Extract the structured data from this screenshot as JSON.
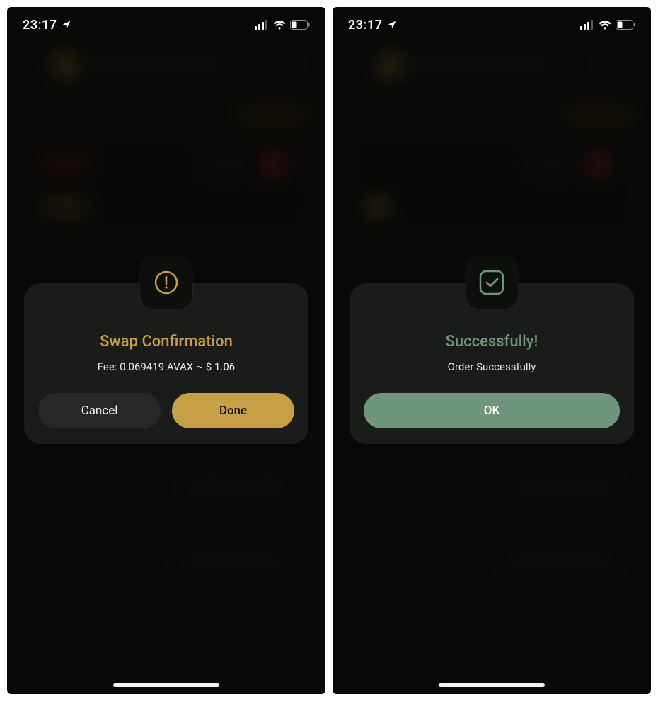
{
  "status": {
    "time": "23:17",
    "location_arrow": "➤"
  },
  "colors": {
    "gold": "#c79f45",
    "green": "#6f957c",
    "modal_bg": "#1a1c19",
    "phone_bg": "#111311"
  },
  "left_screen": {
    "icon": "alert-circle",
    "title": "Swap Confirmation",
    "subtitle": "Fee: 0.069419 AVAX ~ $ 1.06",
    "buttons": {
      "secondary": "Cancel",
      "primary": "Done"
    }
  },
  "right_screen": {
    "icon": "check-square",
    "title": "Successfully!",
    "subtitle": "Order Successfully",
    "buttons": {
      "primary": "OK"
    }
  }
}
